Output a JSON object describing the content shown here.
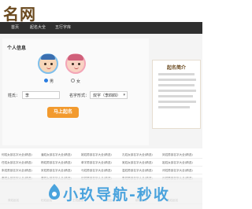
{
  "logo": {
    "text": "名网"
  },
  "nav": {
    "items": [
      "首页",
      "起名大全",
      "五行字库"
    ]
  },
  "form": {
    "section_title": "个人信息",
    "gender": {
      "male_label": "男",
      "female_label": "女",
      "selected": "male"
    },
    "surname": {
      "label": "姓氏：",
      "value": "李"
    },
    "name_type": {
      "label": "名字形式：",
      "value": "双字（李四四）"
    },
    "submit_label": "马上起名"
  },
  "intro": {
    "title": "起名简介"
  },
  "list": {
    "rows": [
      [
        "何姓女孩名字大全(精选)",
        "潘姓女孩名字大全(精选)",
        "姚姓男孩名字大全(精选)",
        "孔姓女孩名字大全(精选)",
        "凤姓男孩名字大全(精选)"
      ],
      [
        "任姓女孩名字大全(精选)",
        "杨姓男孩名字大全(精选)",
        "单字男孩名字大全(精选)",
        "吴姓女孩名字大全(精选)",
        "祖姓女孩名字大全(精选)"
      ],
      [
        "朱姓男孩名字大全(精选)",
        "宋姓男孩名字大全(精选)",
        "马姓男孩名字大全(精选)",
        "温姓男孩名字大全(精选)",
        "邓姓男孩名字大全(精选)"
      ],
      [
        "秦姓女孩名字大全(精选)",
        "唐姓女孩名字大全(精选)",
        "伍姓男孩名字大全(精选)",
        "鲁姓男孩名字大全(精选)",
        "孙姓男孩名字大全(精选)"
      ]
    ],
    "bottom_row": [
      "周姓起名",
      "柏姓起名",
      "王姓起名",
      "吴姓起名",
      "柳姓起名",
      "高姓起名"
    ]
  },
  "watermark": {
    "text": "小玖导航-秒收"
  },
  "colors": {
    "nav_bg": "#2f2f2f",
    "button": "#f29a2e",
    "accent": "#6b4a1f",
    "watermark": "#4aa3dd"
  },
  "icons": [
    "boy-avatar-icon",
    "girl-avatar-icon",
    "radio-icon",
    "dropdown-arrow-icon"
  ]
}
